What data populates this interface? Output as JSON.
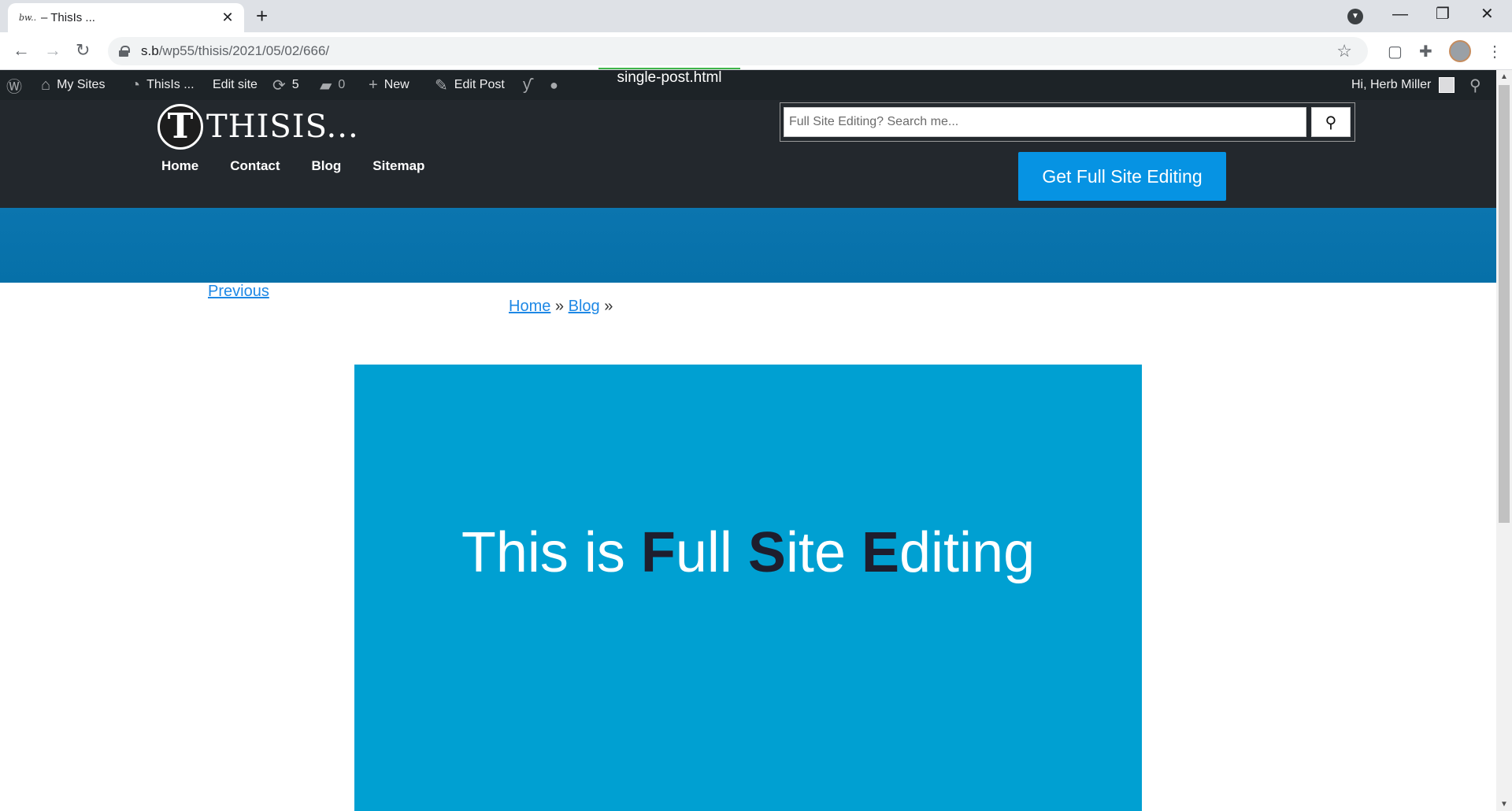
{
  "browser": {
    "tab": {
      "favicon": "bw..",
      "title": "– ThisIs ...",
      "close_label": "✕"
    },
    "new_tab_label": "+",
    "window_controls": {
      "minimize": "—",
      "restore": "❐",
      "close": "✕"
    },
    "url_host": "s.b",
    "url_path": "/wp55/thisis/2021/05/02/666/"
  },
  "adminbar": {
    "my_sites": "My Sites",
    "site_name": "ThisIs ...",
    "edit_site": "Edit site",
    "updates_count": "5",
    "comments_count": "0",
    "new_label": "New",
    "edit_post": "Edit Post",
    "template_file": "single-post.html",
    "greeting": "Hi, Herb Miller"
  },
  "site": {
    "logo_letter": "T",
    "logo_text": "THISIS...",
    "nav": [
      {
        "label": "Home"
      },
      {
        "label": "Contact"
      },
      {
        "label": "Blog"
      },
      {
        "label": "Sitemap"
      }
    ],
    "search_placeholder": "Full Site Editing? Search me...",
    "cta_label": "Get Full Site Editing"
  },
  "content": {
    "previous_link": "Previous",
    "breadcrumb": {
      "home": "Home",
      "sep1": "»",
      "blog": "Blog",
      "sep2": "»"
    },
    "hero": {
      "part1": "This is ",
      "f": "F",
      "part2": "ull ",
      "s": "S",
      "part3": "ite ",
      "e": "E",
      "part4": "diting"
    }
  },
  "colors": {
    "admin_bar": "#1d2327",
    "header": "#23282d",
    "cta": "#0693e3",
    "band": "#0670a8",
    "hero_bg": "#00a0d2",
    "link": "#1e88e5"
  }
}
